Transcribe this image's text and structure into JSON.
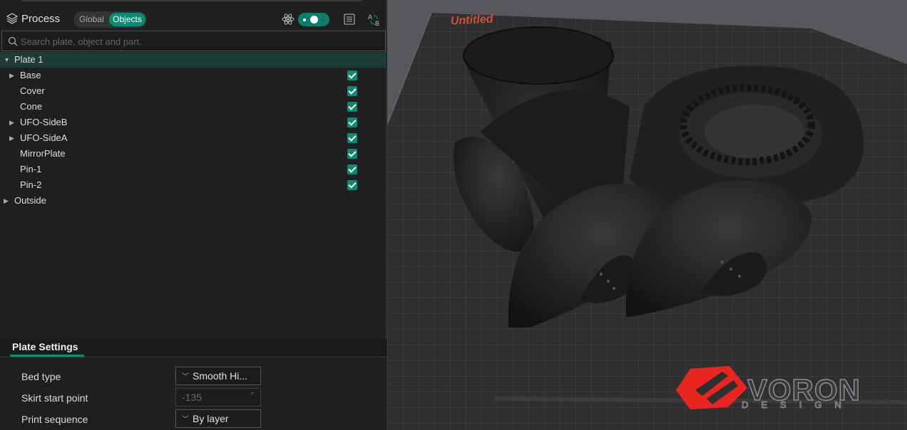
{
  "process_panel": {
    "title": "Process",
    "mode_global_label": "Global",
    "mode_objects_label": "Objects",
    "advanced_toggle_on": true
  },
  "search": {
    "placeholder": "Search plate, object and part."
  },
  "object_tree": {
    "plate": {
      "label": "Plate 1",
      "expanded": true
    },
    "objects": [
      {
        "label": "Base",
        "has_children": true,
        "checked": true
      },
      {
        "label": "Cover",
        "has_children": false,
        "checked": true
      },
      {
        "label": "Cone",
        "has_children": false,
        "checked": true
      },
      {
        "label": "UFO-SideB",
        "has_children": true,
        "checked": true
      },
      {
        "label": "UFO-SideA",
        "has_children": true,
        "checked": true
      },
      {
        "label": "MirrorPlate",
        "has_children": false,
        "checked": true
      },
      {
        "label": "Pin-1",
        "has_children": false,
        "checked": true
      },
      {
        "label": "Pin-2",
        "has_children": false,
        "checked": true
      }
    ],
    "outside": {
      "label": "Outside",
      "expanded": false
    }
  },
  "plate_settings": {
    "tab_label": "Plate Settings",
    "bed_type": {
      "label": "Bed type",
      "value": "Smooth Hi..."
    },
    "skirt_start_point": {
      "label": "Skirt start point",
      "value": "-135",
      "unit": "°"
    },
    "print_sequence": {
      "label": "Print sequence",
      "value": "By layer"
    }
  },
  "viewport": {
    "plate_name": "Untitled",
    "bed_logo_text": "VORON",
    "bed_logo_subtext": "DESIGN",
    "accent_color": "#0b8a76",
    "logo_color": "#e8261f"
  }
}
